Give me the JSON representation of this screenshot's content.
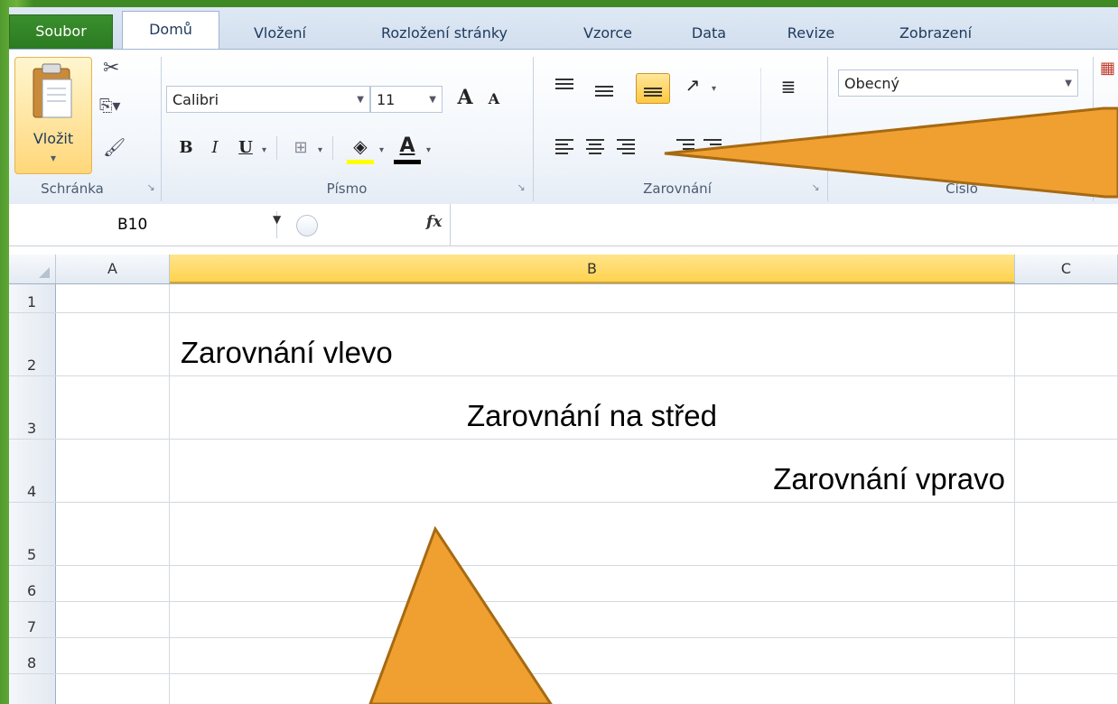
{
  "tabs": {
    "file": "Soubor",
    "home": "Domů",
    "insert": "Vložení",
    "layout": "Rozložení stránky",
    "formulas": "Vzorce",
    "data": "Data",
    "review": "Revize",
    "view": "Zobrazení"
  },
  "ribbon": {
    "clipboard": {
      "paste_label": "Vložit",
      "group_label": "Schránka"
    },
    "font": {
      "font_name": "Calibri",
      "font_size": "11",
      "bold": "B",
      "italic": "I",
      "underline": "U",
      "grow": "A",
      "shrink": "A",
      "font_color": "A",
      "group_label": "Písmo"
    },
    "alignment": {
      "group_label": "Zarovnání"
    },
    "number": {
      "format": "Obecný",
      "group_label": "Číslo"
    }
  },
  "formula_bar": {
    "name_box": "B10",
    "fx": "fx",
    "formula": ""
  },
  "grid": {
    "columns": [
      "A",
      "B",
      "C"
    ],
    "rows": [
      {
        "num": "1",
        "b": ""
      },
      {
        "num": "2",
        "b": "Zarovnání vlevo"
      },
      {
        "num": "3",
        "b": "Zarovnání na střed"
      },
      {
        "num": "4",
        "b": "Zarovnání vpravo"
      },
      {
        "num": "5",
        "b": ""
      },
      {
        "num": "6",
        "b": ""
      },
      {
        "num": "7",
        "b": ""
      },
      {
        "num": "8",
        "b": ""
      }
    ]
  },
  "colors": {
    "accent_green": "#3a8f2c",
    "callout_orange": "#f0a030",
    "selected_header": "#ffd34f"
  }
}
